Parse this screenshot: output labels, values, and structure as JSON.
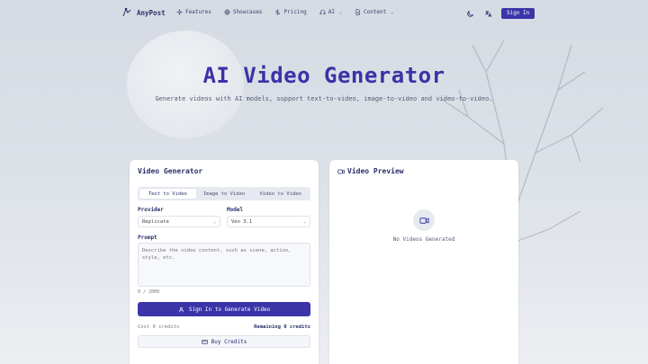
{
  "nav": {
    "brand": "AnyPost",
    "links": [
      {
        "label": "Features",
        "icon": "sparkle-icon"
      },
      {
        "label": "Showcases",
        "icon": "globe-icon"
      },
      {
        "label": "Pricing",
        "icon": "dollar-icon"
      },
      {
        "label": "AI",
        "icon": "headset-icon",
        "dropdown": true
      },
      {
        "label": "Content",
        "icon": "document-icon",
        "dropdown": true
      }
    ],
    "sign_in": "Sign In"
  },
  "hero": {
    "title": "AI Video Generator",
    "subtitle": "Generate videos with AI models, support text-to-video, image-to-video and video-to-video."
  },
  "generator": {
    "title": "Video Generator",
    "tabs": [
      "Text to Video",
      "Image to Video",
      "Video to Video"
    ],
    "active_tab": "Text to Video",
    "provider_label": "Provider",
    "provider_value": "Replicate",
    "model_label": "Model",
    "model_value": "Veo 3.1",
    "prompt_label": "Prompt",
    "prompt_placeholder": "Describe the video content, such as scene, action, style, etc.",
    "counter": "0 / 2000",
    "generate_button": "Sign In to Generate Video",
    "cost": "Cost 0 credits",
    "remaining": "Remaining 0 credits",
    "buy_button": "Buy Credits"
  },
  "preview": {
    "title": "Video Preview",
    "empty_text": "No Videos Generated"
  },
  "colors": {
    "accent": "#3b34a8",
    "title": "#3b32a6",
    "text": "#2b2f6b"
  }
}
